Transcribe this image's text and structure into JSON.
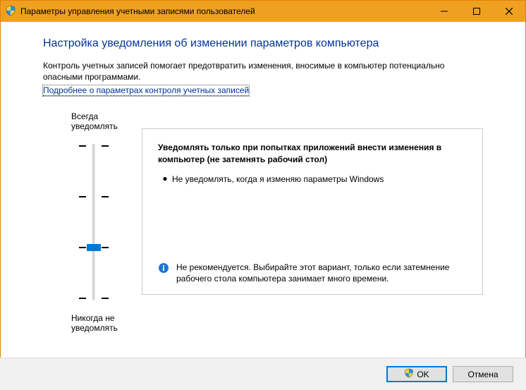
{
  "window": {
    "title": "Параметры управления учетными записями пользователей"
  },
  "heading": "Настройка уведомления об изменении параметров компьютера",
  "desc": "Контроль учетных записей помогает предотвратить изменения, вносимые в компьютер потенциально опасными программами.",
  "link": "Подробнее о параметрах контроля учетных записей",
  "slider": {
    "top_label": "Всегда уведомлять",
    "bottom_label": "Никогда не уведомлять",
    "levels": 4,
    "selected_index": 2
  },
  "panel": {
    "title": "Уведомлять только при попытках приложений внести изменения в компьютер (не затемнять рабочий стол)",
    "bullet": "Не уведомлять, когда я изменяю параметры Windows",
    "recommendation": "Не рекомендуется. Выбирайте этот вариант, только если затемнение рабочего стола компьютера занимает много времени."
  },
  "buttons": {
    "ok": "OK",
    "cancel": "Отмена"
  }
}
